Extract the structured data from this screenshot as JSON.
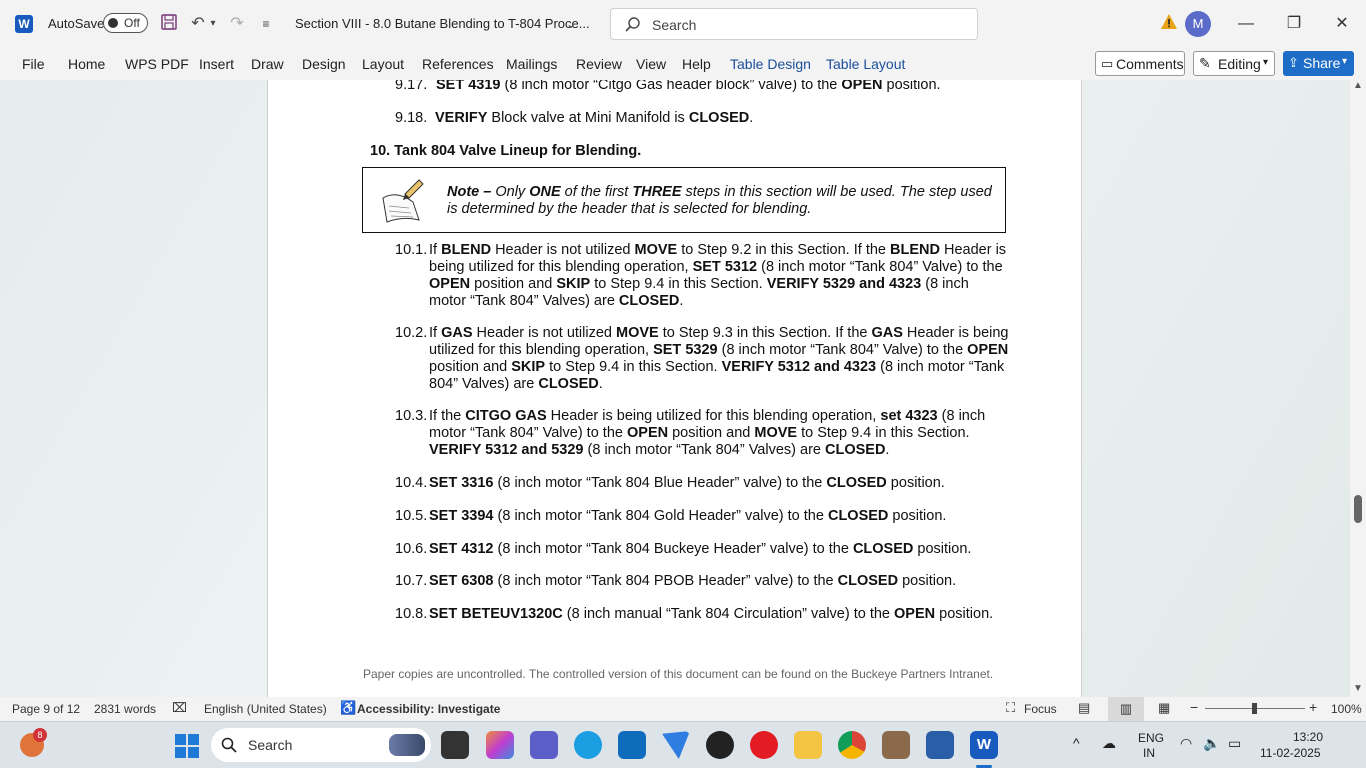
{
  "titlebar": {
    "app_icon": "word-icon",
    "autosave_label": "AutoSave",
    "autosave_state": "Off",
    "doc_title": "Section VIII - 8.0 Butane Blending to T-804 Proce...",
    "search_placeholder": "Search",
    "avatar_initial": "M"
  },
  "ribbon": {
    "tabs": [
      "File",
      "Home",
      "WPS PDF",
      "Insert",
      "Draw",
      "Design",
      "Layout",
      "References",
      "Mailings",
      "Review",
      "View",
      "Help",
      "Table Design",
      "Table Layout"
    ],
    "comments_label": "Comments",
    "editing_label": "Editing",
    "share_label": "Share"
  },
  "document": {
    "step_9_17": {
      "num": "9.17.",
      "bold1": "SET 4319",
      "rest1": " (8 inch motor “Citgo Gas header block” valve) to the ",
      "bold2": "OPEN",
      "rest2": " position."
    },
    "step_9_18": {
      "num": "9.18.",
      "bold1": "VERIFY",
      "rest1": " Block valve at Mini Manifold is ",
      "bold2": "CLOSED",
      "rest2": "."
    },
    "heading_10": "10.  Tank 804 Valve Lineup for Blending.",
    "note": {
      "label": "Note –",
      "t1": " Only ",
      "b1": "ONE",
      "t2": " of the first ",
      "b2": "THREE",
      "t3": " steps in this section will be used. The step used is determined by the header that is selected for blending."
    },
    "step_10_1": {
      "num": "10.1.",
      "parts": [
        "If ",
        "BLEND",
        " Header is not utilized ",
        "MOVE",
        " to Step 9.2 in this Section. If the ",
        "BLEND",
        " Header is being utilized for this blending operation, ",
        "SET 5312",
        " (8 inch motor “Tank 804” Valve) to the ",
        "OPEN",
        " position and ",
        "SKIP",
        " to Step 9.4 in this Section. ",
        "VERIFY 5329 and 4323",
        " (8 inch motor “Tank 804” Valves) are ",
        "CLOSED",
        "."
      ]
    },
    "step_10_2": {
      "num": "10.2.",
      "parts": [
        "If ",
        "GAS",
        " Header is not utilized ",
        "MOVE",
        " to Step 9.3 in this Section. If the ",
        "GAS",
        " Header is being utilized for this blending operation, ",
        "SET 5329",
        " (8 inch motor “Tank 804” Valve) to the ",
        "OPEN",
        " position and ",
        "SKIP",
        " to Step 9.4 in this Section. ",
        "VERIFY 5312 and 4323",
        " (8 inch motor “Tank 804” Valves) are ",
        "CLOSED",
        "."
      ]
    },
    "step_10_3": {
      "num": "10.3.",
      "parts": [
        "If the ",
        "CITGO GAS",
        " Header is being utilized for this blending operation, ",
        "set 4323",
        " (8 inch motor “Tank 804” Valve) to the ",
        "OPEN",
        " position and ",
        "MOVE",
        " to Step 9.4 in this Section. ",
        "VERIFY 5312 and 5329",
        " (8 inch motor “Tank 804” Valves) are ",
        "CLOSED",
        "."
      ]
    },
    "step_10_4": {
      "num": "10.4.",
      "bold1": "SET 3316",
      "rest1": " (8 inch motor “Tank 804 Blue Header” valve) to the ",
      "bold2": "CLOSED",
      "rest2": " position."
    },
    "step_10_5": {
      "num": "10.5.",
      "bold1": "SET 3394",
      "rest1": " (8 inch motor “Tank 804 Gold Header” valve) to the ",
      "bold2": "CLOSED",
      "rest2": " position."
    },
    "step_10_6": {
      "num": "10.6.",
      "bold1": "SET 4312",
      "rest1": " (8 inch motor “Tank 804 Buckeye Header” valve) to the ",
      "bold2": "CLOSED",
      "rest2": " position."
    },
    "step_10_7": {
      "num": "10.7.",
      "bold1": "SET 6308",
      "rest1": " (8 inch motor “Tank 804 PBOB Header” valve) to the ",
      "bold2": "CLOSED",
      "rest2": " position."
    },
    "step_10_8": {
      "num": "10.8.",
      "bold1": "SET BETEUV1320C",
      "rest1": " (8 inch manual “Tank 804 Circulation” valve) to the ",
      "bold2": "OPEN",
      "rest2": " position."
    },
    "footer": "Paper copies are uncontrolled. The controlled version of this document can be found on the Buckeye Partners Intranet."
  },
  "scrollbar": {
    "position_fraction": 0.72
  },
  "statusbar": {
    "page": "Page 9 of 12",
    "words": "2831 words",
    "language": "English (United States)",
    "accessibility": "Accessibility: Investigate",
    "focus": "Focus",
    "zoom": "100%"
  },
  "taskbar": {
    "notification_count": "8",
    "search_label": "Search",
    "lang_line1": "ENG",
    "lang_line2": "IN",
    "time": "13:20",
    "date": "11-02-2025"
  },
  "colors": {
    "word_blue": "#185abd",
    "share_blue": "#1e6ec8",
    "context_tab": "#1a4f9c"
  }
}
